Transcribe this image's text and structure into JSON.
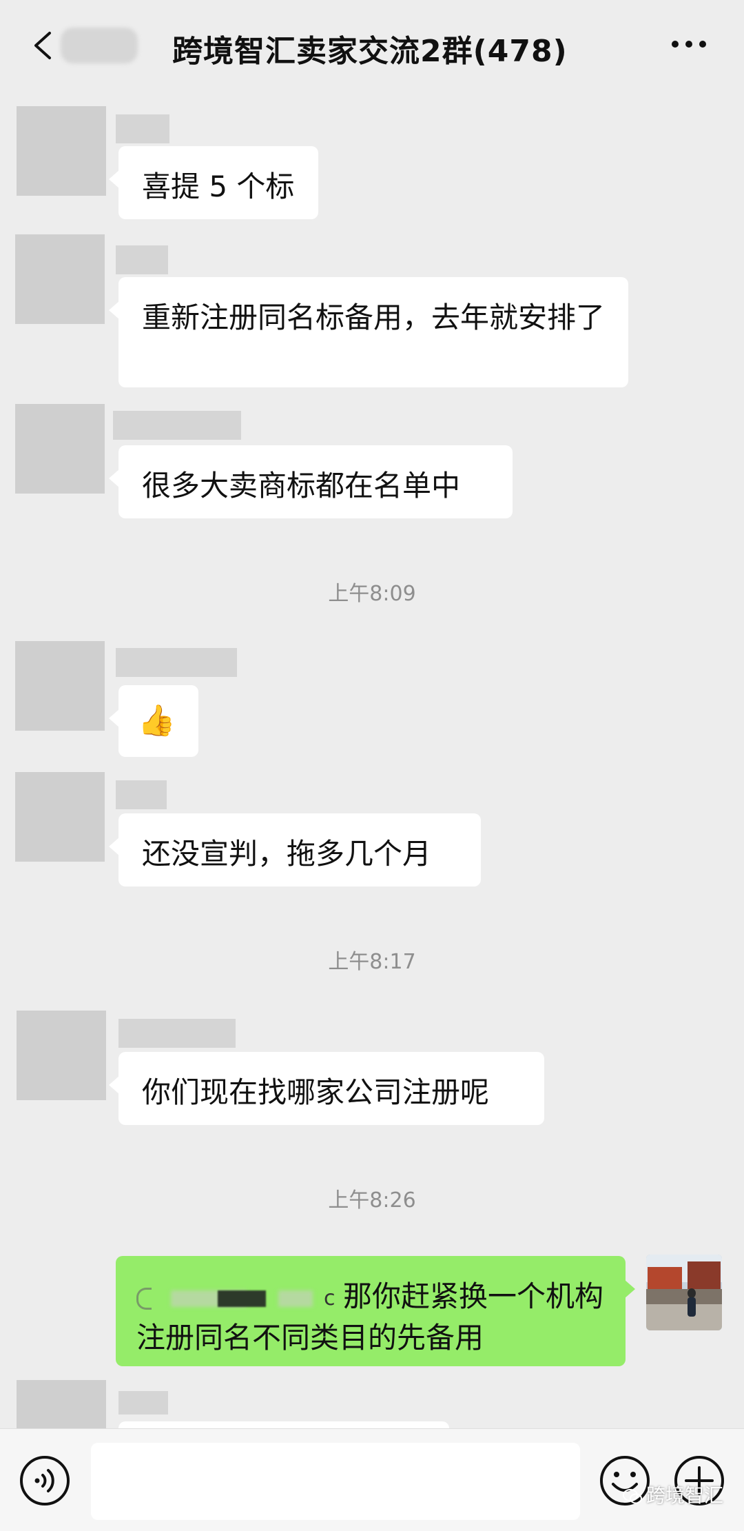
{
  "header": {
    "title": "跨境智汇卖家交流2群(478)"
  },
  "messages": [
    {
      "text": "喜提 5 个标"
    },
    {
      "text": "重新注册同名标备用，去年就安排了"
    },
    {
      "text": "很多大卖商标都在名单中"
    },
    {
      "emoji": "👍"
    },
    {
      "text": "还没宣判，拖多几个月"
    },
    {
      "text": "你们现在找哪家公司注册呢"
    },
    {
      "text": "那你赶紧换一个机构注册同名不同类目的先备用"
    }
  ],
  "timestamps": [
    "上午8:09",
    "上午8:17",
    "上午8:26"
  ],
  "watermark": "跨境智汇",
  "icons": [
    "back-icon",
    "more-icon",
    "voice-icon",
    "emoji-icon",
    "plus-icon"
  ],
  "colors": {
    "self_bubble": "#95ec69",
    "background": "#ededed"
  }
}
